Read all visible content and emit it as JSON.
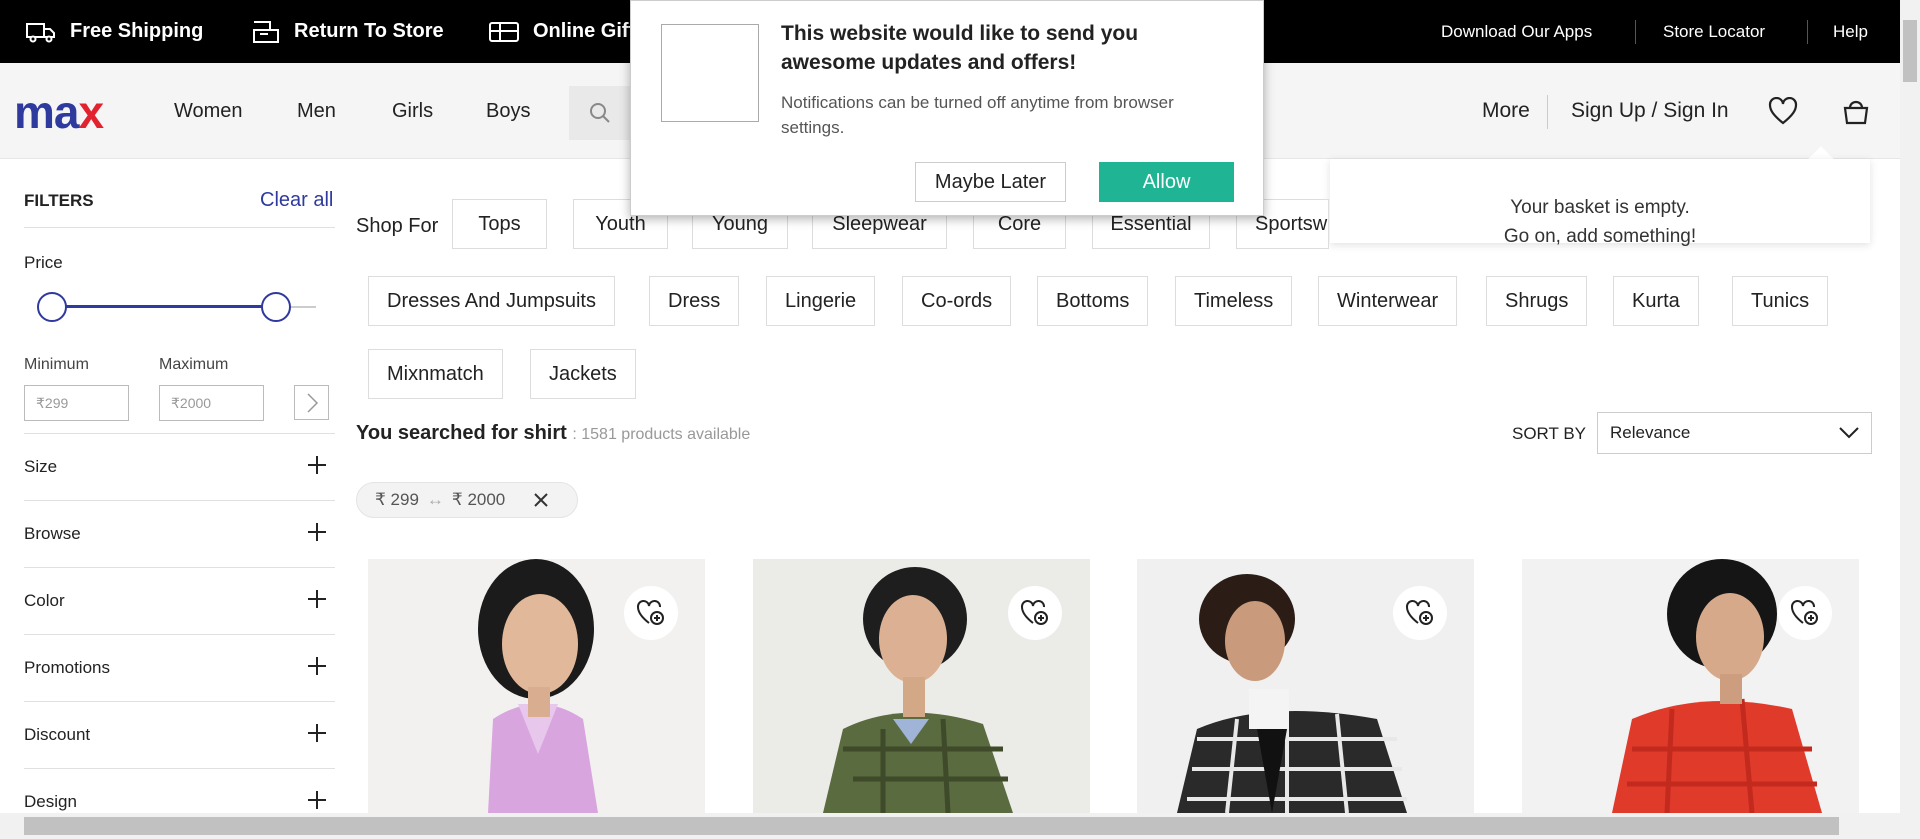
{
  "topbar": {
    "free_shipping": "Free Shipping",
    "return_to_store": "Return To Store",
    "online_gift": "Online Gift",
    "download_apps": "Download Our Apps",
    "store_locator": "Store Locator",
    "help": "Help"
  },
  "header": {
    "logo_ma": "ma",
    "logo_x": "x",
    "nav": [
      "Women",
      "Men",
      "Girls",
      "Boys"
    ],
    "more": "More",
    "signin": "Sign Up / Sign In"
  },
  "basket": {
    "line1": "Your basket is empty.",
    "line2": "Go on, add something!"
  },
  "filters": {
    "title": "FILTERS",
    "clear_all": "Clear all",
    "price_title": "Price",
    "min_label": "Minimum",
    "max_label": "Maximum",
    "min_placeholder": "₹299",
    "max_placeholder": "₹2000",
    "facets": [
      "Size",
      "Browse",
      "Color",
      "Promotions",
      "Discount",
      "Design"
    ]
  },
  "shop_for": {
    "label": "Shop For",
    "chips_row1": [
      "Tops",
      "Youth",
      "Young",
      "Sleepwear",
      "Core",
      "Essential",
      "Sportswe"
    ],
    "chips_row2": [
      "Dresses And Jumpsuits",
      "Dress",
      "Lingerie",
      "Co-ords",
      "Bottoms",
      "Timeless",
      "Winterwear",
      "Shrugs",
      "Kurta",
      "Tunics"
    ],
    "chips_row3": [
      "Mixnmatch",
      "Jackets"
    ]
  },
  "results": {
    "searched_prefix": "You searched for shirt",
    "count_text": ": 1581 products available",
    "sort_label": "SORT BY",
    "sort_value": "Relevance"
  },
  "active_filter": {
    "min": "₹ 299",
    "arrows": "↔",
    "max": "₹ 2000"
  },
  "products": [
    {
      "color": "#d9a5df",
      "bg": "#f3f1f0"
    },
    {
      "color": "#5a6b3f",
      "bg": "#ebebe8"
    },
    {
      "color": "#2a2a2a",
      "bg": "#f0f0f0"
    },
    {
      "color": "#e03a2a",
      "bg": "#f2f2f2"
    }
  ],
  "popup": {
    "title": "This website would like to send you awesome updates and offers!",
    "subtitle": "Notifications can be turned off anytime from browser settings.",
    "later": "Maybe Later",
    "allow": "Allow"
  }
}
